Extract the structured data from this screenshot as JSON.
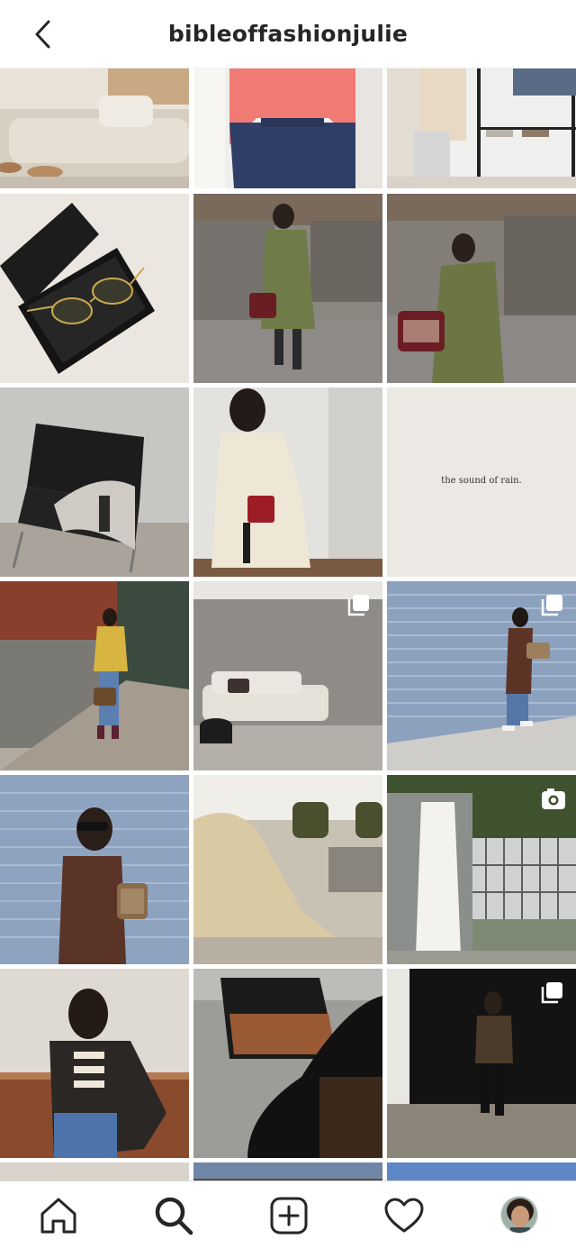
{
  "header": {
    "title": "bibleoffashionjulie",
    "back_icon": "chevron-left-icon"
  },
  "grid": {
    "rows": 6,
    "columns": 3,
    "tiles": [
      {
        "id": "post-1",
        "badge": null
      },
      {
        "id": "post-2",
        "badge": null
      },
      {
        "id": "post-3",
        "badge": null
      },
      {
        "id": "post-4",
        "badge": null
      },
      {
        "id": "post-5",
        "badge": null
      },
      {
        "id": "post-6",
        "badge": null
      },
      {
        "id": "post-7",
        "badge": null
      },
      {
        "id": "post-8",
        "badge": null
      },
      {
        "id": "post-9",
        "badge": null,
        "text": "the sound of rain."
      },
      {
        "id": "post-10",
        "badge": null
      },
      {
        "id": "post-11",
        "badge": "carousel-icon"
      },
      {
        "id": "post-12",
        "badge": "carousel-icon"
      },
      {
        "id": "post-13",
        "badge": null
      },
      {
        "id": "post-14",
        "badge": null
      },
      {
        "id": "post-15",
        "badge": "video-icon"
      },
      {
        "id": "post-16",
        "badge": null
      },
      {
        "id": "post-17",
        "badge": null
      },
      {
        "id": "post-18",
        "badge": "carousel-icon"
      }
    ]
  },
  "tabbar": {
    "items": [
      {
        "name": "home",
        "icon": "home-icon"
      },
      {
        "name": "search",
        "icon": "search-icon",
        "active": true
      },
      {
        "name": "create",
        "icon": "plus-square-icon"
      },
      {
        "name": "activity",
        "icon": "heart-icon"
      },
      {
        "name": "profile",
        "icon": "avatar"
      }
    ]
  },
  "colors": {
    "text": "#262626",
    "divider": "#dbdbdb",
    "background": "#ffffff"
  }
}
